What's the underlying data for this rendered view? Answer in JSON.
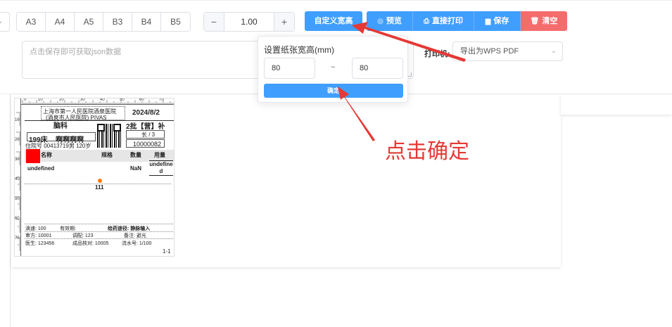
{
  "toolbar": {
    "paper_sizes": [
      "A3",
      "A4",
      "A5",
      "B3",
      "B4",
      "B5"
    ],
    "zoom": {
      "value": "1.00",
      "minus": "−",
      "plus": "+"
    },
    "custom_size_label": "自定义宽高",
    "preview_label": "预览",
    "direct_print_label": "直接打印",
    "save_label": "保存",
    "clear_label": "清空"
  },
  "json_area": {
    "placeholder": "点击保存即可获取json数据"
  },
  "printer": {
    "label": "打印机:",
    "selected": "导出为WPS PDF"
  },
  "popover": {
    "title": "设置纸张宽高(mm)",
    "width_value": "80",
    "separator": "~",
    "height_value": "80",
    "confirm_label": "确定"
  },
  "label": {
    "ruler_top": [
      "0",
      "10",
      "20",
      "30",
      "40",
      "50",
      "60",
      "70"
    ],
    "ruler_left": [
      "10",
      "20",
      "30",
      "40",
      "50",
      "60",
      "70"
    ],
    "hospital_line1": "上海市第一人民医院酒泉医院",
    "hospital_line2": "(酒泉市人民医院) PIVAS",
    "date": "2024/8/2",
    "department": "脑科",
    "batch": "2批【营】补",
    "bed": "199床",
    "patient_name": "啊啊啊啊",
    "long_term": "长 / 3",
    "admission": "住院号 00413719男 120岁",
    "order_no": "10000082",
    "col_name": "名称",
    "col_spec": "规格",
    "col_qty": "数量",
    "col_dose": "用量",
    "drug_name": "undefined",
    "drug_qty": "NaN",
    "drug_dose": "undefined",
    "total": "111",
    "drip_speed": "滴速: 100",
    "expiry": "有效期:",
    "route": "给药途径: 静脉输入",
    "checker": "审方: 10001",
    "dispenser": "调配: 123",
    "remark": "备注: 避光",
    "doctor": "医生: 123456",
    "verifier": "成品核对: 10005",
    "serial": "流水号: 1/100",
    "page": "1-1"
  },
  "annotation": {
    "text": "点击确定",
    "color": "#e53935"
  },
  "colors": {
    "primary": "#409eff",
    "danger": "#f56c6c",
    "marker": "#ff7a10"
  }
}
